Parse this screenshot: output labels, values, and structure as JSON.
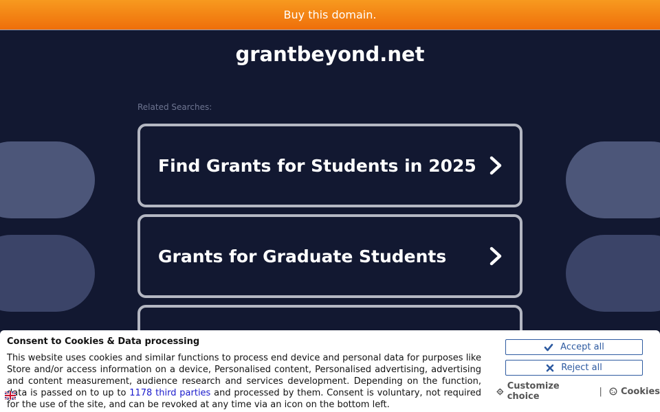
{
  "topbar": {
    "label": "Buy this domain."
  },
  "domain": {
    "title": "grantbeyond.net"
  },
  "related": {
    "label": "Related Searches:",
    "items": [
      {
        "label": "Find Grants for Students in 2025"
      },
      {
        "label": "Grants for Graduate Students"
      },
      {
        "label": ""
      }
    ]
  },
  "consent": {
    "title": "Consent to Cookies & Data processing",
    "body_before_link": "This website uses cookies and similar functions to process end device and personal data for purposes like Store and/or access information on a device, Personalised content, Personalised advertising, advertising and content measurement, audience research and services development. Depending on the function, data is passed on to up to ",
    "link": "1178 third parties",
    "body_after_link": " and processed by them. Consent is voluntary, not required for the use of the site, and can be revoked at any time via an icon on the bottom left.",
    "accept_label": "Accept all",
    "reject_label": "Reject all",
    "customize_label": "Customize choice",
    "separator": "|",
    "cookies_label": "Cookies"
  },
  "icons": {
    "chevron": "chevron-right-icon",
    "accept": "check-icon",
    "reject": "close-icon",
    "customize": "gear-icon",
    "cookies": "cookie-icon",
    "flag": "uk-flag-icon"
  },
  "colors": {
    "background": "#121831",
    "topbar": "#f28212",
    "card_border": "#b4b7c2",
    "button_blue": "#2d5aa0"
  }
}
